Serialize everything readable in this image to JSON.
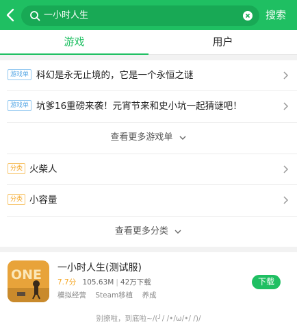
{
  "search": {
    "query": "一小时人生",
    "button_label": "搜索"
  },
  "tabs": [
    {
      "label": "游戏",
      "active": true
    },
    {
      "label": "用户",
      "active": false
    }
  ],
  "game_lists": {
    "tag": "游戏单",
    "items": [
      {
        "title": "科幻是永无止境的，它是一个永恒之谜"
      },
      {
        "title": "坑爹16重磅来袭！元宵节来和史小坑一起猜谜吧！"
      }
    ],
    "more_label": "查看更多游戏单"
  },
  "categories": {
    "tag": "分类",
    "items": [
      {
        "title": "火柴人"
      },
      {
        "title": "小容量"
      }
    ],
    "more_label": "查看更多分类"
  },
  "app": {
    "name": "一小时人生(测试服)",
    "score": "7.7分",
    "size": "105.63M",
    "downloads": "42万下载",
    "tags": [
      "模拟经营",
      "Steam移植",
      "养成"
    ],
    "download_label": "下载",
    "icon_text": "ONE"
  },
  "footer": {
    "text": "别撩啦，到底啦~/(╯/ /•/ω/•/ /)/"
  },
  "colors": {
    "brand_green": "#1fbf62",
    "search_box": "#18a955",
    "tag_blue": "#5aa9e6",
    "tag_orange": "#f5a623",
    "score_orange": "#f5a623"
  }
}
